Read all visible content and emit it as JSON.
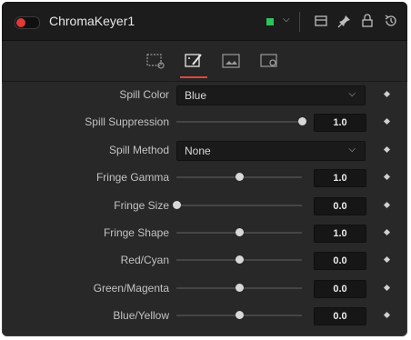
{
  "header": {
    "title": "ChromaKeyer1",
    "color_chip": "#2ec45a",
    "enabled_color": "#e03a3a",
    "icons": [
      "version-icon",
      "pin-icon",
      "lock-icon",
      "reset-icon"
    ]
  },
  "tabs": [
    {
      "name": "tab-controls",
      "icon": "screen-icon",
      "active": false
    },
    {
      "name": "tab-color",
      "icon": "wand-icon",
      "active": true
    },
    {
      "name": "tab-image",
      "icon": "image-icon",
      "active": false
    },
    {
      "name": "tab-settings",
      "icon": "gear-icon",
      "active": false
    }
  ],
  "accent": "#e0463c",
  "controls": [
    {
      "type": "dropdown",
      "label": "Spill Color",
      "value": "Blue"
    },
    {
      "type": "slider",
      "label": "Spill Suppression",
      "value": "1.0",
      "fraction": 1.0
    },
    {
      "type": "dropdown",
      "label": "Spill Method",
      "value": "None"
    },
    {
      "type": "slider",
      "label": "Fringe Gamma",
      "value": "1.0",
      "fraction": 0.5
    },
    {
      "type": "slider",
      "label": "Fringe Size",
      "value": "0.0",
      "fraction": 0.0
    },
    {
      "type": "slider",
      "label": "Fringe Shape",
      "value": "1.0",
      "fraction": 0.5
    },
    {
      "type": "slider",
      "label": "Red/Cyan",
      "value": "0.0",
      "fraction": 0.5
    },
    {
      "type": "slider",
      "label": "Green/Magenta",
      "value": "0.0",
      "fraction": 0.5
    },
    {
      "type": "slider",
      "label": "Blue/Yellow",
      "value": "0.0",
      "fraction": 0.5
    }
  ]
}
